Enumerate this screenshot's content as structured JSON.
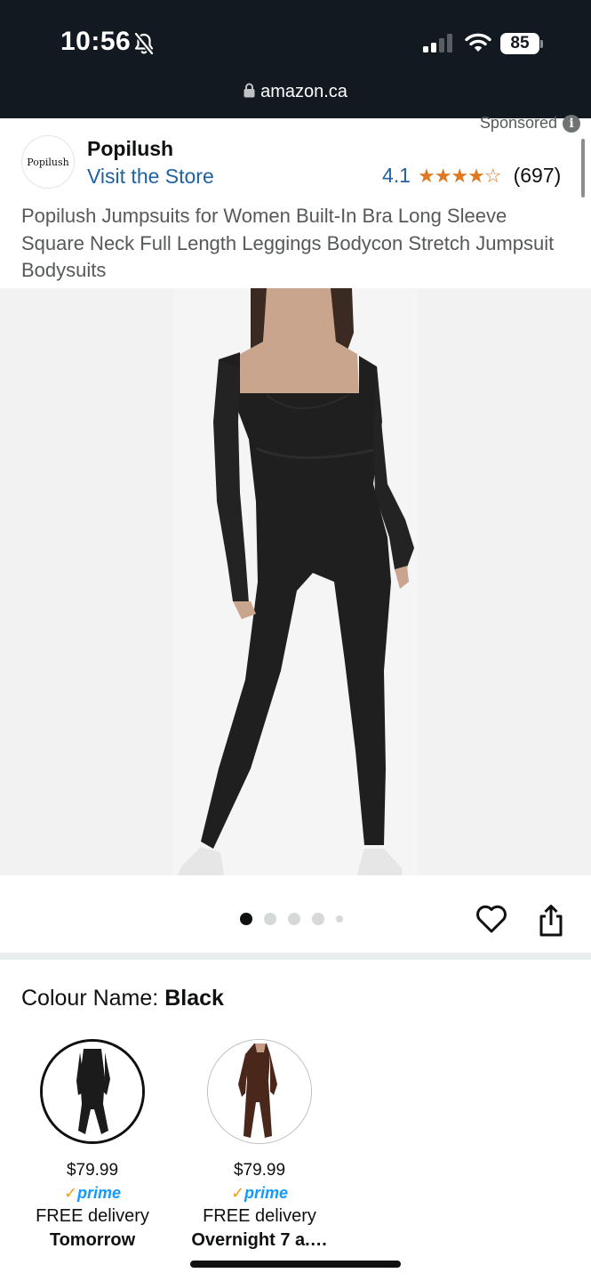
{
  "status_bar": {
    "time": "10:56",
    "battery": "85",
    "url": "amazon.ca"
  },
  "brand": {
    "sponsored_label": "Sponsored",
    "logo_text": "Popilush",
    "name": "Popilush",
    "visit_store": "Visit the Store",
    "rating_value": "4.1",
    "rating_stars": "★★★★☆",
    "rating_fraction": 0.82,
    "rating_count": "(697)"
  },
  "product": {
    "title": "Popilush Jumpsuits for Women Built-In Bra Long Sleeve Square Neck Full Length Leggings Bodycon Stretch Jumpsuit Bodysuits",
    "image_count": 5,
    "active_image": 1
  },
  "colour": {
    "label": "Colour Name:",
    "selected": "Black"
  },
  "options": [
    {
      "color": "#1b1b1b",
      "price": "$79.99",
      "prime_check": "✓",
      "prime": "prime",
      "delivery": "FREE delivery",
      "when": "Tomorrow"
    },
    {
      "color": "#4a271b",
      "price": "$79.99",
      "prime_check": "✓",
      "prime": "prime",
      "delivery": "FREE delivery",
      "when": "Overnight 7 a.…"
    }
  ],
  "colors": {
    "header_bg": "#131921",
    "link": "#2162a1",
    "star": "#de7921",
    "prime": "#1399ff"
  }
}
